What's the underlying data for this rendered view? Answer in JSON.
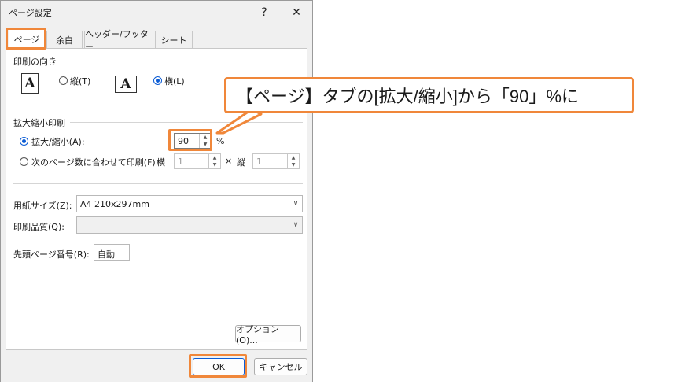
{
  "dialog": {
    "title": "ページ設定",
    "help_icon": "?",
    "close_icon": "✕"
  },
  "tabs": [
    {
      "label": "ページ",
      "active": true
    },
    {
      "label": "余白",
      "active": false
    },
    {
      "label": "ヘッダー/フッター",
      "active": false
    },
    {
      "label": "シート",
      "active": false
    }
  ],
  "orientation": {
    "section_label": "印刷の向き",
    "portrait_label": "縦(T)",
    "landscape_label": "横(L)",
    "selected": "landscape",
    "icon_glyph": "A"
  },
  "scaling": {
    "section_label": "拡大縮小印刷",
    "adjust_label": "拡大/縮小(A):",
    "adjust_value": "90",
    "percent": "%",
    "fit_label": "次のページ数に合わせて印刷(F):",
    "wide_label": "横",
    "wide_value": "1",
    "times": "×",
    "tall_label": "縦",
    "tall_value": "1",
    "selected": "adjust"
  },
  "paper": {
    "size_label": "用紙サイズ(Z):",
    "size_value": "A4 210x297mm",
    "quality_label": "印刷品質(Q):",
    "quality_value": "",
    "first_page_label": "先頭ページ番号(R):",
    "first_page_value": "自動"
  },
  "buttons": {
    "options": "オプション(O)...",
    "ok": "OK",
    "cancel": "キャンセル"
  },
  "annotation": {
    "text": "【ページ】タブの[拡大/縮小]から「90」%に",
    "color": "#f0873a"
  }
}
